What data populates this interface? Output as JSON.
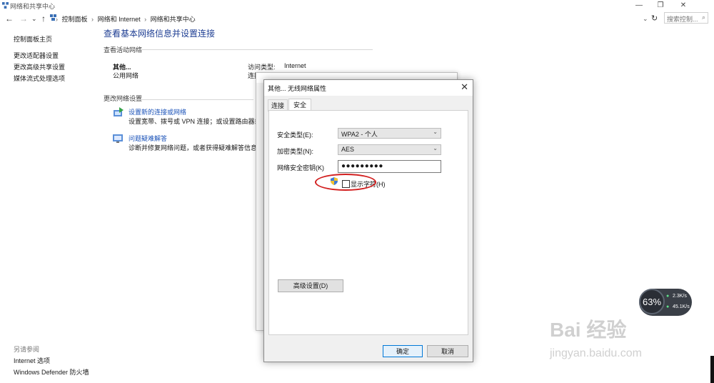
{
  "window": {
    "title": "网络和共享中心",
    "min": "—",
    "restore": "❐",
    "close": "✕"
  },
  "nav": {
    "back": "←",
    "forward": "→",
    "dropdown": "⌄",
    "up": "↑",
    "crumbs": [
      "控制面板",
      "网络和 Internet",
      "网络和共享中心"
    ],
    "crumb_sep": "›",
    "refresh": "↻",
    "search_placeholder": "搜索控制...",
    "search_icon": "⌕"
  },
  "sidebar": {
    "items": [
      "控制面板主页",
      "更改适配器设置",
      "更改高级共享设置",
      "媒体流式处理选项"
    ],
    "see_also_heading": "另请参阅",
    "see_also": [
      "Internet 选项",
      "Windows Defender 防火墙"
    ]
  },
  "main": {
    "title": "查看基本网络信息并设置连接",
    "active_networks_label": "查看活动网络",
    "network_name": "其他...",
    "network_type": "公用网络",
    "access_type_label": "访问类型:",
    "access_type_value": "Internet",
    "connection_label_partial": "连接",
    "change_settings_label": "更改网络设置",
    "actions": [
      {
        "title": "设置新的连接或网络",
        "desc": "设置宽带、拨号或 VPN 连接；或设置路由器或接入"
      },
      {
        "title": "问题疑难解答",
        "desc": "诊断并修复网络问题，或者获得疑难解答信息。"
      }
    ]
  },
  "dialog": {
    "title": "其他... 无线网络属性",
    "close": "✕",
    "tabs": [
      "连接",
      "安全"
    ],
    "security_type_label": "安全类型(E):",
    "security_type_value": "WPA2 - 个人",
    "encryption_label": "加密类型(N):",
    "encryption_value": "AES",
    "key_label": "网络安全密钥(K)",
    "key_value": "●●●●●●●●●",
    "show_chars_label": "显示字符(H)",
    "show_chars_checked": false,
    "advanced_button": "高级设置(D)",
    "ok_button": "确定",
    "cancel_button": "取消",
    "chevron": "⌄"
  },
  "speed_widget": {
    "percent": "63%",
    "up": "2.3K/s",
    "down": "45.1K/s"
  },
  "watermark": {
    "brand": "Bai 经验",
    "url": "jingyan.baidu.com"
  },
  "colors": {
    "accent": "#0078d7",
    "link": "#1a52b8",
    "title": "#1e3e93",
    "highlight": "#d21f1f"
  }
}
